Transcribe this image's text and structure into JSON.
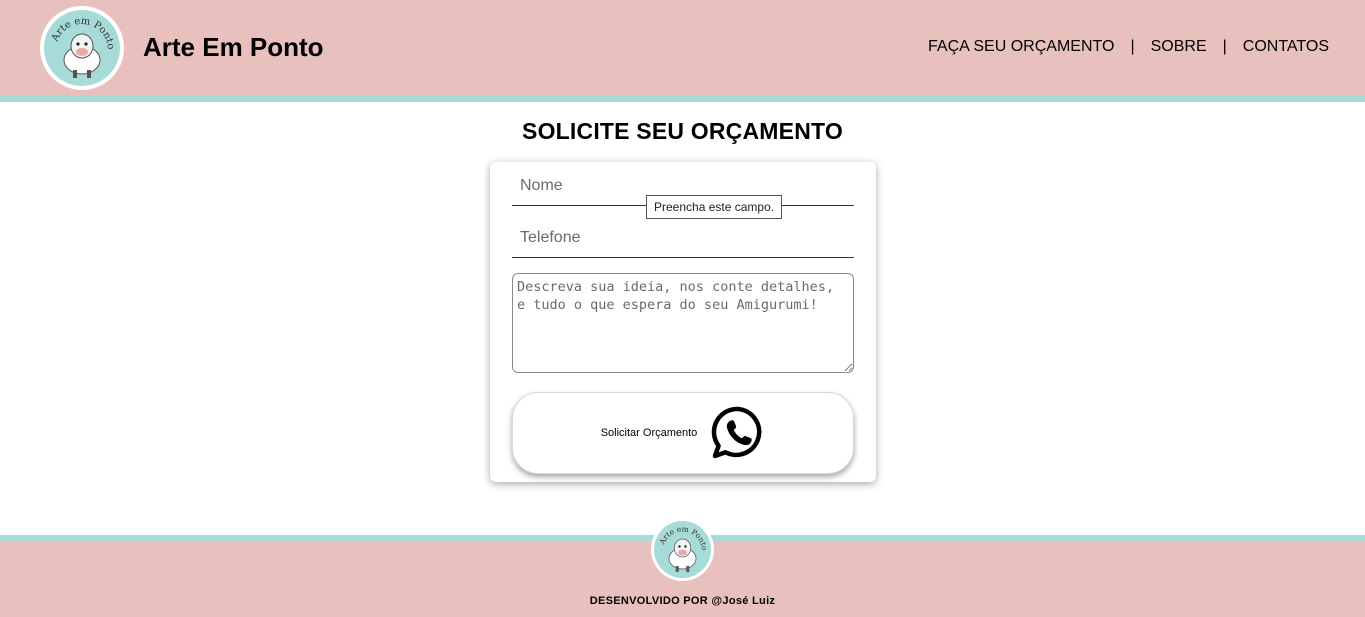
{
  "header": {
    "logo_text": "Arte em Ponto",
    "brand": "Arte Em Ponto",
    "nav": [
      {
        "label": "FAÇA SEU ORÇAMENTO"
      },
      {
        "label": "SOBRE"
      },
      {
        "label": "CONTATOS"
      }
    ],
    "separator": "|"
  },
  "main": {
    "title": "SOLICITE SEU ORÇAMENTO",
    "form": {
      "name_placeholder": "Nome",
      "phone_placeholder": "Telefone",
      "idea_placeholder": "Descreva sua ideia, nos conte detalhes, e tudo o que espera do seu Amigurumi!",
      "validation_tooltip": "Preencha este campo.",
      "submit_label": "Solicitar Orçamento",
      "submit_icon": "whatsapp-icon"
    }
  },
  "footer": {
    "logo_text": "Arte em Ponto",
    "credit": "DESENVOLVIDO POR @José Luiz"
  },
  "colors": {
    "pink": "#e8c1bf",
    "teal": "#a7dbd8"
  }
}
